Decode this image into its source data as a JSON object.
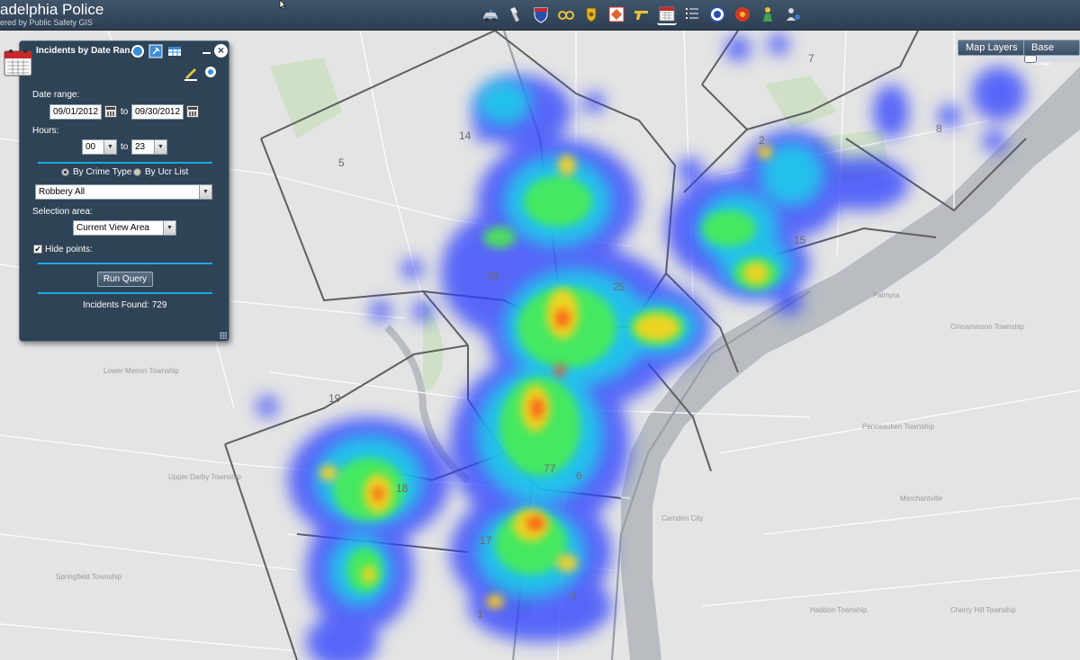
{
  "app": {
    "title": "adelphia Police",
    "subtitle": "ered by Public Safety GIS"
  },
  "toolbar": {
    "tools": [
      {
        "icon": "police-car-icon"
      },
      {
        "icon": "flashlight-icon"
      },
      {
        "icon": "interstate-shield-icon"
      },
      {
        "icon": "handcuffs-icon"
      },
      {
        "icon": "badge-icon"
      },
      {
        "icon": "warning-sign-icon"
      },
      {
        "icon": "gun-icon"
      },
      {
        "icon": "calendar-icon",
        "active": true
      },
      {
        "icon": "list-icon"
      },
      {
        "icon": "seal-icon"
      },
      {
        "icon": "sunburst-icon"
      },
      {
        "icon": "person-award-icon"
      },
      {
        "icon": "user-settings-icon"
      }
    ]
  },
  "map": {
    "map_layers_label": "Map Layers",
    "base_map_label": "Base Map",
    "district_labels": [
      "7",
      "8",
      "14",
      "5",
      "2",
      "15",
      "39",
      "25",
      "3",
      "19",
      "18",
      "6",
      "1",
      "17",
      "77"
    ],
    "place_labels": [
      "Pennsauken Township",
      "Cinnaminson Township",
      "Merchantville",
      "Haddon Township",
      "Camden City",
      "Cherry Hill Township",
      "Lower Merion Township",
      "Upper Darby Township",
      "Springfield Township",
      "Palmyra"
    ]
  },
  "panel": {
    "title": "Incidents by Date Ran...",
    "date_range_label": "Date range:",
    "date_from": "09/01/2012",
    "to_label": "to",
    "date_to": "09/30/2012",
    "hours_label": "Hours:",
    "hour_from": "00",
    "hour_to": "23",
    "by_crime_type_label": "By Crime Type",
    "by_ucr_list_label": "By Ucr List",
    "crime_type": "Robbery All",
    "selection_area_label": "Selection area:",
    "selection_area": "Current View Area",
    "hide_points_label": "Hide points:",
    "hide_points_checked": "✔",
    "run_query_label": "Run Query",
    "incidents_found": "Incidents Found: 729"
  },
  "colors": {
    "topbar": "#34495f",
    "panel": "#2f4357",
    "accent": "#1ea7e1"
  }
}
